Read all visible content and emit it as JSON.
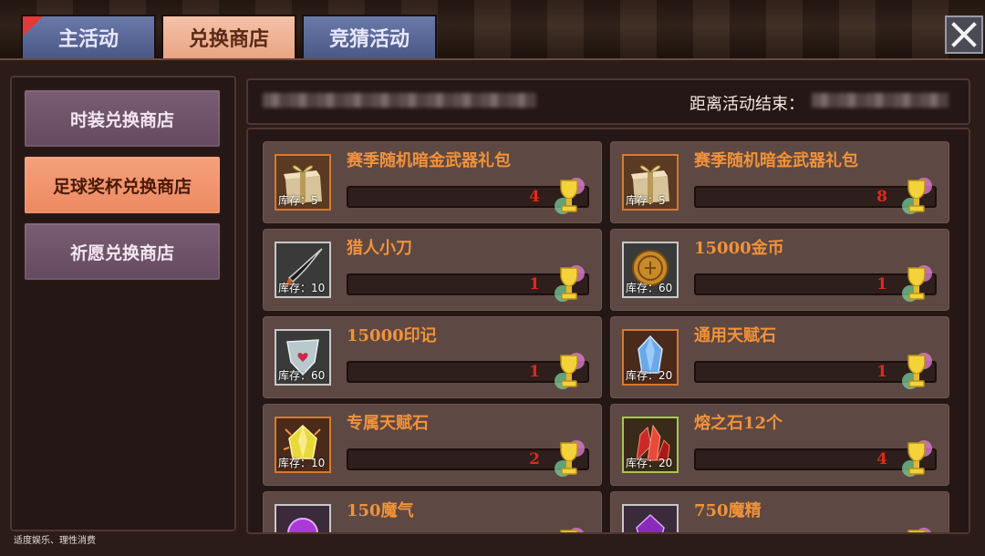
{
  "tabs": [
    {
      "label": "主活动",
      "active": false,
      "flag": true
    },
    {
      "label": "兑换商店",
      "active": true,
      "flag": false
    },
    {
      "label": "竞猜活动",
      "active": false,
      "flag": false
    }
  ],
  "close_icon": "close-icon",
  "sidebar": {
    "items": [
      {
        "label": "时装兑换商店",
        "active": false
      },
      {
        "label": "足球奖杯兑换商店",
        "active": true
      },
      {
        "label": "祈愿兑换商店",
        "active": false
      }
    ]
  },
  "infobar": {
    "countdown_label": "距离活动结束："
  },
  "footer_note": "适度娱乐、理性消费",
  "currency_icon": "trophy-icon",
  "colors": {
    "item_name": "#f0923a",
    "price": "#e02a1a",
    "tab_active": "#e9a584",
    "sidebar_active": "#ec8a62"
  },
  "items": [
    {
      "name": "赛季随机暗金武器礼包",
      "stock_label": "库存：",
      "stock": "5",
      "price": "4",
      "icon": "gift-box-icon"
    },
    {
      "name": "赛季随机暗金武器礼包",
      "stock_label": "库存：",
      "stock": "5",
      "price": "8",
      "icon": "gift-box-icon"
    },
    {
      "name": "猎人小刀",
      "stock_label": "库存：",
      "stock": "10",
      "price": "1",
      "icon": "knife-icon"
    },
    {
      "name": "15000金币",
      "stock_label": "库存：",
      "stock": "60",
      "price": "1",
      "icon": "gold-coin-icon"
    },
    {
      "name": "15000印记",
      "stock_label": "库存：",
      "stock": "60",
      "price": "1",
      "icon": "emblem-icon"
    },
    {
      "name": "通用天赋石",
      "stock_label": "库存：",
      "stock": "20",
      "price": "1",
      "icon": "blue-crystal-icon"
    },
    {
      "name": "专属天赋石",
      "stock_label": "库存：",
      "stock": "10",
      "price": "2",
      "icon": "yellow-crystal-icon"
    },
    {
      "name": "熔之石12个",
      "stock_label": "库存：",
      "stock": "20",
      "price": "4",
      "icon": "red-crystal-icon"
    },
    {
      "name": "150魔气",
      "icon": "purple-orb-icon"
    },
    {
      "name": "750魔精",
      "icon": "purple-gem-icon"
    }
  ]
}
